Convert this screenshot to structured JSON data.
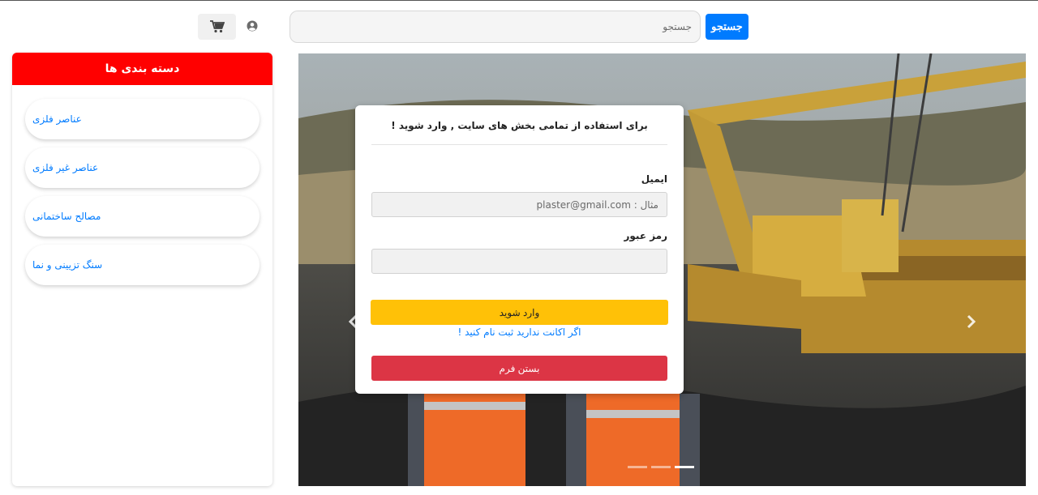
{
  "header": {
    "search_button_label": "جستجو",
    "search_placeholder": "جستجو",
    "cart_icon": "cart-icon",
    "user_icon": "user-circle-icon"
  },
  "sidebar": {
    "title": "دسته بندی ها",
    "accent_color": "#ff0000",
    "items": [
      {
        "label": "عناصر فلزی"
      },
      {
        "label": "عناصر غیر فلزی"
      },
      {
        "label": "مصالح ساختمانی"
      },
      {
        "label": "سنگ تزیینی و نما"
      }
    ]
  },
  "carousel": {
    "prev_icon": "chevron-left-icon",
    "next_icon": "chevron-right-icon",
    "slide_count": 3,
    "active_slide": 3
  },
  "login_modal": {
    "title": "برای استفاده از تمامی بخش های سایت , وارد شوید !",
    "email_label": "ایمیل",
    "email_placeholder": "مثال : plaster@gmail.com",
    "password_label": "رمز عبور",
    "password_placeholder": "",
    "login_button": "وارد شوید",
    "register_link": "اگر اکانت ندارید ثبت نام کنید !",
    "close_button": "بستن فرم",
    "colors": {
      "primary": "#007bff",
      "warning": "#ffc107",
      "danger": "#dc3545"
    }
  }
}
